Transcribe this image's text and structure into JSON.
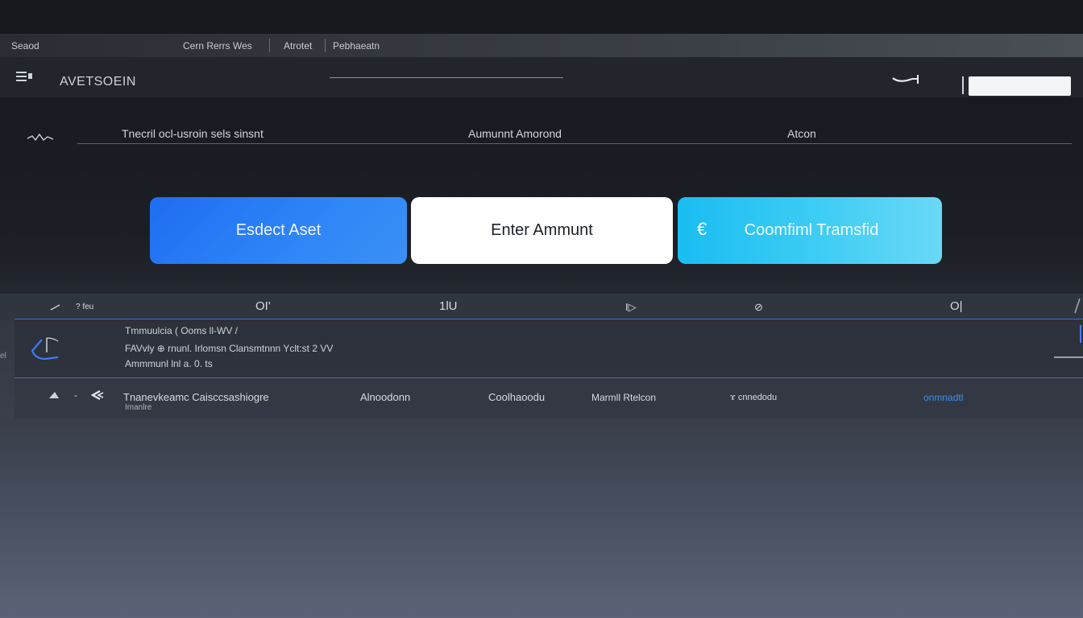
{
  "menubar": {
    "items": [
      {
        "label": "Seaod"
      },
      {
        "label": "Cern Rerrs Wes"
      },
      {
        "label": "Atrotet"
      },
      {
        "label": "Pebhaeatn"
      }
    ]
  },
  "header": {
    "title": "AVETSOEIN",
    "search_placeholder": ""
  },
  "columns": {
    "col1": "Tnecril ocl-usroin sels sinsnt",
    "col2": "Aumunnt Amorond",
    "col3": "Atcon"
  },
  "steps": {
    "select_label": "Esdect Aset",
    "amount_label": "Enter Ammunt",
    "confirm_label": "Coomfiml Tramsfid",
    "confirm_icon": "€"
  },
  "table": {
    "headers": [
      "? feu",
      "OI'",
      "1lU",
      "I▷",
      "⊘",
      "O|"
    ],
    "left_tick": "el",
    "row1": {
      "line1": "Tmmuulcia ( Ooms ll-WV /",
      "line2": "FAVvly ⊕ rnunl. Irlomsn Clansmtnnn Yclt:st 2 VV",
      "line3": "Ammmunl lnl a. 0. ts"
    },
    "row2": {
      "col1": "Tnanevkeamc Caisccsashiogre",
      "col1_sub": "Imanlre",
      "col2": "Alnoodonn",
      "col3": "Coolhaoodu",
      "col4": "Marmll Rtelcon",
      "col5": "ɤ cnnedodu",
      "link": "onmnadtl"
    }
  },
  "colors": {
    "accent_blue": "#1f6df2",
    "accent_cyan": "#19bdf1",
    "link_blue": "#3a8ff0"
  }
}
